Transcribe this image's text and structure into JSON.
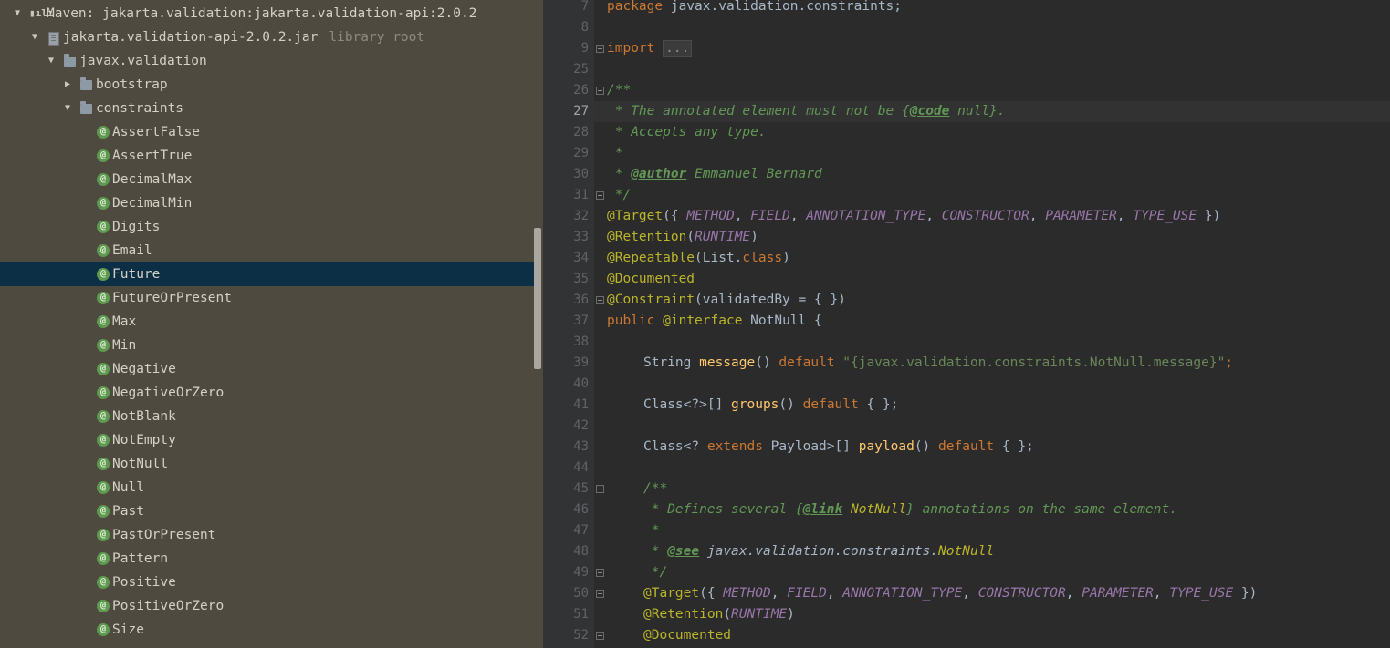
{
  "project_tree": {
    "maven_root": "Maven: jakarta.validation:jakarta.validation-api:2.0.2",
    "jar": "jakarta.validation-api-2.0.2.jar",
    "jar_hint": "library root",
    "package": "javax.validation",
    "folders": [
      "bootstrap",
      "constraints"
    ],
    "selected": "Future",
    "classes": [
      "AssertFalse",
      "AssertTrue",
      "DecimalMax",
      "DecimalMin",
      "Digits",
      "Email",
      "Future",
      "FutureOrPresent",
      "Max",
      "Min",
      "Negative",
      "NegativeOrZero",
      "NotBlank",
      "NotEmpty",
      "NotNull",
      "Null",
      "Past",
      "PastOrPresent",
      "Pattern",
      "Positive",
      "PositiveOrZero",
      "Size"
    ]
  },
  "editor": {
    "current_line": "27",
    "line_numbers": [
      "7",
      "8",
      "9",
      "25",
      "26",
      "27",
      "28",
      "29",
      "30",
      "31",
      "32",
      "33",
      "34",
      "35",
      "36",
      "37",
      "38",
      "39",
      "40",
      "41",
      "42",
      "43",
      "44",
      "45",
      "46",
      "47",
      "48",
      "49",
      "50",
      "51",
      "52"
    ],
    "code": {
      "package_kw": "package",
      "package_name": "javax.validation.constraints;",
      "import_kw": "import",
      "import_fold": "...",
      "doc_open": "/**",
      "doc_line1_a": " * The annotated element must not be {",
      "doc_line1_tag": "@code",
      "doc_line1_b": " null}.",
      "doc_line2": " * Accepts any type.",
      "doc_line3": " *",
      "doc_line4_a": " * ",
      "doc_line4_tag": "@author",
      "doc_line4_b": " Emmanuel Bernard",
      "doc_close": " */",
      "target": "@Target",
      "target_open": "({ ",
      "target_args": [
        "METHOD",
        "FIELD",
        "ANNOTATION_TYPE",
        "CONSTRUCTOR",
        "PARAMETER",
        "TYPE_USE"
      ],
      "target_close": " })",
      "retention": "@Retention",
      "runtime": "RUNTIME",
      "repeatable": "@Repeatable",
      "list_class_a": "List.",
      "class_kw": "class",
      "documented": "@Documented",
      "constraint": "@Constraint",
      "validated_by": "(validatedBy = { })",
      "public_kw": "public",
      "interface_kw": "@interface",
      "type_name": "NotNull {",
      "string_type": "String ",
      "message_fn": "message",
      "default_kw": "default",
      "message_value": "\"{javax.validation.constraints.NotNull.message}\"",
      "groups_type": "Class<?>[] ",
      "groups_fn": "groups",
      "payload_type_a": "Class<? ",
      "extends_kw": "extends",
      "payload_type_b": " Payload>[] ",
      "payload_fn": "payload",
      "empty_default": " { };",
      "doc2_open": "/**",
      "doc2_line1_a": " * Defines several {",
      "doc2_line1_tag": "@link",
      "doc2_line1_ref": "NotNull",
      "doc2_line1_b": "} annotations on the same element.",
      "doc2_line2": " *",
      "doc2_line3_a": " * ",
      "doc2_line3_tag": "@see",
      "doc2_line3_ref": " javax.validation.constraints.",
      "doc2_line3_nn": "NotNull",
      "doc2_close": " */"
    }
  },
  "colors": {
    "tree_bg": "#4e4a40",
    "selection": "#0d2f45",
    "editor_bg": "#2b2b2b",
    "keyword": "#cc7832",
    "annotation": "#bbb529",
    "comment": "#629755",
    "constant": "#9876aa",
    "string": "#6a8759",
    "method": "#ffc66d"
  }
}
